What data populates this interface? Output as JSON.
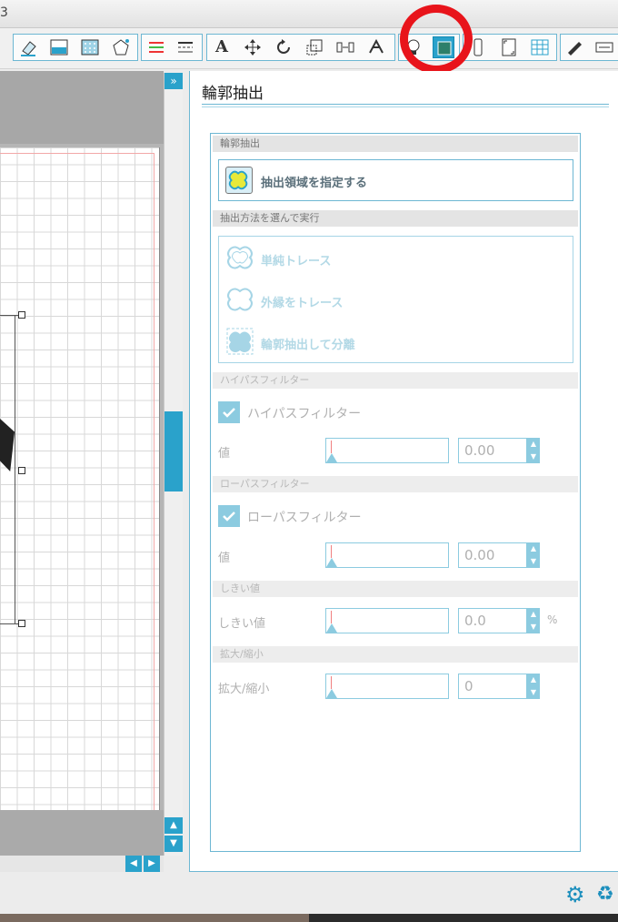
{
  "window": {
    "title_fragment": "3"
  },
  "toolbar": {
    "groups": [
      {
        "buttons": [
          "eraser-icon",
          "fill-icon",
          "pattern-icon",
          "pentagon-icon"
        ]
      },
      {
        "buttons": [
          "line-color-icon",
          "line-style-icon"
        ]
      },
      {
        "buttons": [
          "text-icon",
          "move-icon",
          "rotate-icon",
          "scale-icon",
          "align-icon",
          "replicate-icon"
        ]
      },
      {
        "buttons": [
          "trace-icon",
          "trace-area-icon"
        ]
      },
      {
        "buttons": [
          "cutter-icon",
          "page-setup-icon",
          "grid-icon"
        ]
      },
      {
        "buttons": [
          "send-icon",
          "print-icon"
        ]
      }
    ],
    "text_button_label": "A"
  },
  "panel": {
    "title": "輪郭抽出",
    "section_extract": "輪郭抽出",
    "specify_area_label": "抽出領域を指定する",
    "section_method": "抽出方法を選んで実行",
    "methods": [
      "単純トレース",
      "外縁をトレース",
      "輪郭抽出して分離"
    ],
    "section_highpass": "ハイパスフィルター",
    "highpass_check_label": "ハイパスフィルター",
    "highpass_value_label": "値",
    "highpass_value": "0.00",
    "section_lowpass": "ローパスフィルター",
    "lowpass_check_label": "ローパスフィルター",
    "lowpass_value_label": "値",
    "lowpass_value": "0.00",
    "section_threshold": "しきい値",
    "threshold_label": "しきい値",
    "threshold_value": "0.0",
    "threshold_unit": "%",
    "section_scale": "拡大/縮小",
    "scale_label": "拡大/縮小",
    "scale_value": "0"
  },
  "scroll": {
    "expand_glyph": "»"
  },
  "colors": {
    "accent": "#2aa2cb",
    "annotation": "#e8141b"
  }
}
